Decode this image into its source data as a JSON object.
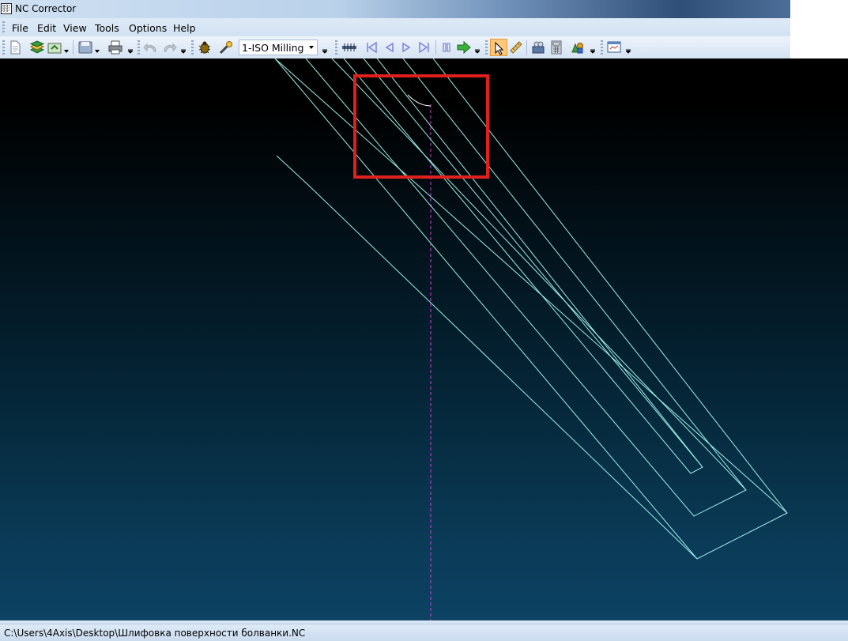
{
  "window": {
    "title": "NC Corrector"
  },
  "menu": {
    "items": [
      {
        "label": "File"
      },
      {
        "label": "Edit"
      },
      {
        "label": "View"
      },
      {
        "label": "Tools"
      },
      {
        "label": "Options"
      },
      {
        "label": "Help"
      }
    ]
  },
  "toolbar": {
    "mode_select_value": "1-ISO Milling",
    "icons": [
      "new-file-icon",
      "layers-icon",
      "open-folder-icon",
      "save-icon",
      "print-icon",
      "undo-icon",
      "redo-icon",
      "bug-icon",
      "wand-icon",
      "ruler-bar-icon",
      "first-step-icon",
      "prev-step-icon",
      "next-step-icon",
      "last-step-icon",
      "pause-icon",
      "run-arrow-icon",
      "select-cursor-icon",
      "measure-ruler-icon",
      "tool-library-icon",
      "calculator-icon",
      "shapes-icon",
      "screen-settings-icon"
    ]
  },
  "colors": {
    "highlight_box": "#e0201c",
    "toolpath": "#9ef0e8",
    "axis_line": "#d040d0",
    "active_tool_bg": "#ffc878"
  },
  "status": {
    "file_path": "C:\\Users\\4Axis\\Desktop\\Шлифовка поверхности болванки.NC"
  }
}
